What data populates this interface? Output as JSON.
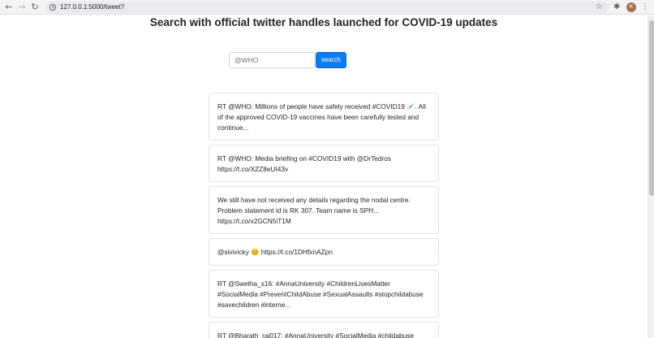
{
  "browser": {
    "url": "127.0.0.1:5000/tweet?",
    "avatar_letter": "K",
    "back_glyph": "←",
    "forward_glyph": "→",
    "reload_glyph": "↻",
    "star_glyph": "☆",
    "extensions_glyph": "✱",
    "menu_glyph": "⋮"
  },
  "page": {
    "title": "Search with official twitter handles launched for COVID-19 updates"
  },
  "search": {
    "placeholder": "@WHO",
    "value": "",
    "button_label": "search"
  },
  "tweets": [
    {
      "text": "RT @WHO: Millions of people have safely received #COVID19 💉. All of the approved COVID-19 vaccines have been carefully tested and continue..."
    },
    {
      "text": "RT @WHO: Media briefing on #COVID19 with @DrTedros https://t.co/XZZ8eUI43v"
    },
    {
      "text": "We still have not received any details regarding the nodal centre. Problem statement id is RK 307. Team name is SPH... https://t.co/x2GCN5iT1M"
    },
    {
      "text": "@sivivicky 😊 https://t.co/1DHfxnAZpn"
    },
    {
      "text": "RT @Swetha_s16: #AnnaUniversity #ChildrenLivesMatter #SocialMedia #PreventChildAbuse #SexualAssaults #stopchildabuse #savechildren #interne..."
    },
    {
      "text": "RT @Bharath_raj017: #AnnaUniversity #SocialMedia #childabuse"
    }
  ]
}
